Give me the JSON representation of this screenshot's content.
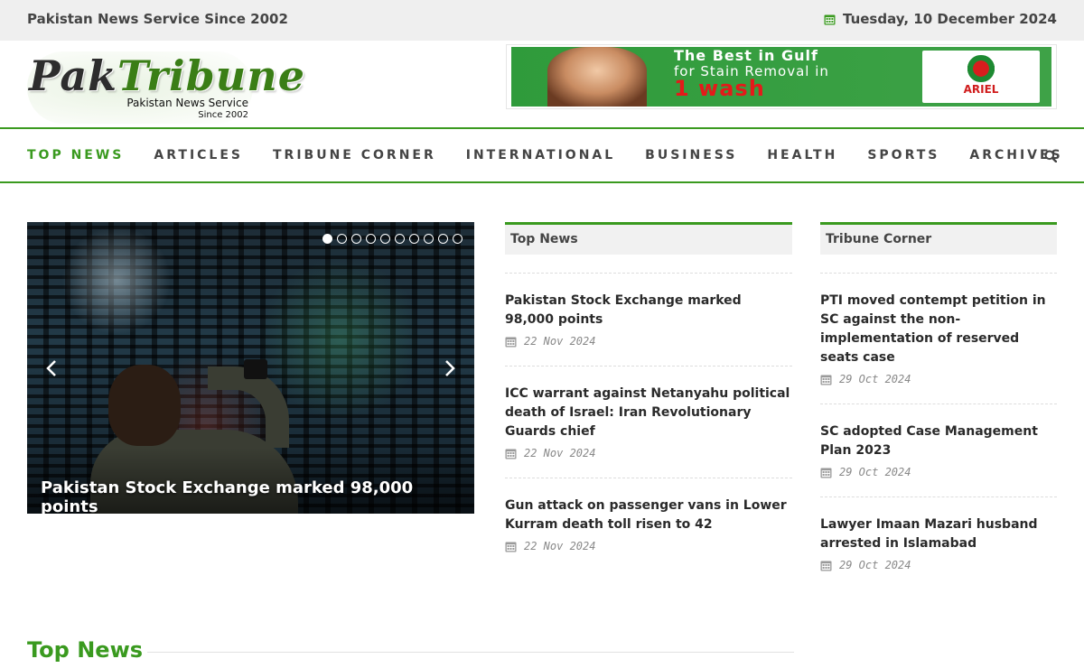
{
  "topbar": {
    "tagline": "Pakistan News Service Since 2002",
    "date": "Tuesday, 10 December 2024"
  },
  "logo": {
    "part1": "Pak",
    "part2": "Tribune",
    "subtitle": "Pakistan News Service",
    "since": "Since 2002"
  },
  "ad": {
    "line1": "The Best in Gulf",
    "line2": "for Stain Removal in",
    "line3": "1 wash",
    "brand": "ARIEL"
  },
  "nav": {
    "items": [
      "TOP NEWS",
      "ARTICLES",
      "TRIBUNE CORNER",
      "INTERNATIONAL",
      "BUSINESS",
      "HEALTH",
      "SPORTS",
      "ARCHIVES"
    ],
    "active_index": 0
  },
  "slider": {
    "caption": "Pakistan Stock Exchange marked 98,000 points",
    "slide_count": 10,
    "active_slide": 0
  },
  "top_news": {
    "heading": "Top News",
    "items": [
      {
        "title": "Pakistan Stock Exchange marked 98,000 points",
        "date": "22 Nov 2024"
      },
      {
        "title": "ICC warrant against Netanyahu political death of Israel: Iran Revolutionary Guards chief",
        "date": "22 Nov 2024"
      },
      {
        "title": "Gun attack on passenger vans in Lower Kurram death toll risen to 42",
        "date": "22 Nov 2024"
      }
    ]
  },
  "tribune_corner": {
    "heading": "Tribune Corner",
    "items": [
      {
        "title": "PTI moved contempt petition in SC against the non-implementation of reserved seats case",
        "date": "29 Oct 2024"
      },
      {
        "title": "SC adopted Case Management Plan 2023",
        "date": "29 Oct 2024"
      },
      {
        "title": "Lawyer Imaan Mazari husband arrested in Islamabad",
        "date": "29 Oct 2024"
      }
    ]
  },
  "section": {
    "heading": "Top News"
  },
  "colors": {
    "accent": "#3a9a1f",
    "topbar_bg": "#efefef"
  }
}
